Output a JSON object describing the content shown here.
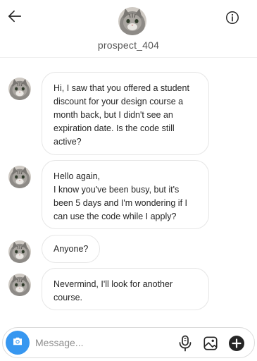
{
  "header": {
    "username": "prospect_404",
    "back_icon": "arrow-left-icon",
    "info_icon": "info-circle-icon"
  },
  "messages": [
    {
      "text": "Hi, I saw that you offered a student discount for your design course a month back, but I didn't see an expiration date. Is the code still active?"
    },
    {
      "text": "Hello again,\nI know you've been busy, but it's been 5 days and I'm wondering if I can use the code while I apply?"
    },
    {
      "text": "Anyone?"
    },
    {
      "text": "Nevermind, I'll look for another course."
    }
  ],
  "composer": {
    "placeholder": "Message...",
    "value": "",
    "camera_icon": "camera-icon",
    "mic_icon": "microphone-icon",
    "gallery_icon": "image-icon",
    "add_icon": "plus-circle-icon"
  },
  "colors": {
    "accent": "#3797f0",
    "bubble_border": "#e6e6e6",
    "text": "#262626"
  }
}
